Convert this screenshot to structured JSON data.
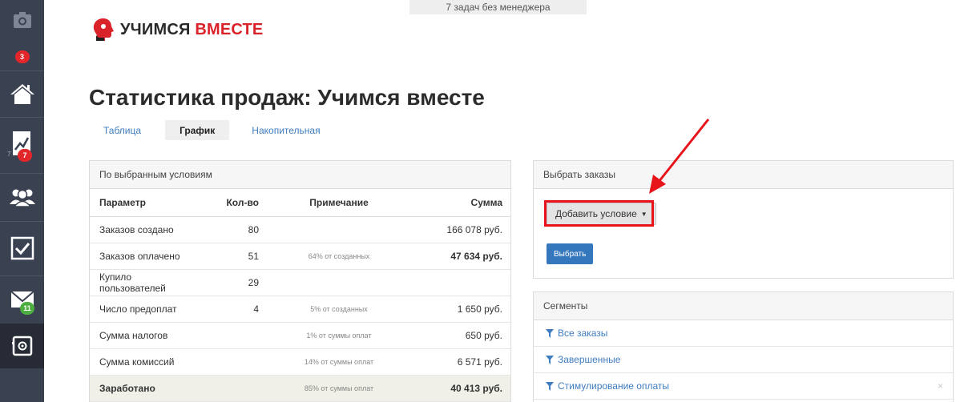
{
  "sidebar": {
    "items": [
      {
        "icon": "camera-icon",
        "badge": ""
      },
      {
        "icon": "notification-badge",
        "badge": "3"
      },
      {
        "icon": "home-icon",
        "badge": ""
      },
      {
        "icon": "chart-icon",
        "badge": "7",
        "sub": "7"
      },
      {
        "icon": "users-icon",
        "badge": ""
      },
      {
        "icon": "tasks-checkbox-icon",
        "badge": ""
      },
      {
        "icon": "mail-icon",
        "badge": "11"
      },
      {
        "icon": "safe-icon",
        "badge": ""
      }
    ],
    "badge_colors": {
      "red": "#e2262a",
      "green": "#4caf3f"
    }
  },
  "notice": {
    "text": "7 задач без менеджера"
  },
  "logo": {
    "word1": "УЧИМСЯ",
    "word2": "ВМЕСТЕ",
    "accent": "#d92229"
  },
  "page": {
    "title": "Статистика продаж: Учимся вместе"
  },
  "tabs": [
    {
      "label": "Таблица",
      "active": false
    },
    {
      "label": "График",
      "active": true
    },
    {
      "label": "Накопительная",
      "active": false
    }
  ],
  "stats": {
    "heading": "По выбранным условиям",
    "columns": {
      "param": "Параметр",
      "count": "Кол-во",
      "note": "Примечание",
      "sum": "Сумма"
    },
    "rows": [
      {
        "param": "Заказов создано",
        "count": "80",
        "note": "",
        "sum": "166 078 руб."
      },
      {
        "param": "Заказов оплачено",
        "count": "51",
        "note": "64% от созданных",
        "sum": "47 634 руб."
      },
      {
        "param": "Купило пользователей",
        "count": "29",
        "note": "",
        "sum": ""
      },
      {
        "param": "Число предоплат",
        "count": "4",
        "note": "5% от созданных",
        "sum": "1 650 руб."
      },
      {
        "param": "Сумма налогов",
        "count": "",
        "note": "1% от суммы оплат",
        "sum": "650 руб."
      },
      {
        "param": "Сумма комиссий",
        "count": "",
        "note": "14% от суммы оплат",
        "sum": "6 571 руб."
      }
    ],
    "total": {
      "param": "Заработано",
      "count": "",
      "note": "85% от суммы оплат",
      "sum": "40 413 руб."
    }
  },
  "orders": {
    "heading": "Выбрать заказы",
    "add_condition": "Добавить условие",
    "select_button": "Выбрать"
  },
  "segments": {
    "heading": "Сегменты",
    "items": [
      "Все заказы",
      "Завершенные",
      "Стимулирование оплаты"
    ],
    "close_glyph": "×"
  },
  "colors": {
    "link": "#3f7cc0",
    "primary_button": "#3577bd",
    "highlight": "#e8141c",
    "sidebar": "#3a4252"
  }
}
